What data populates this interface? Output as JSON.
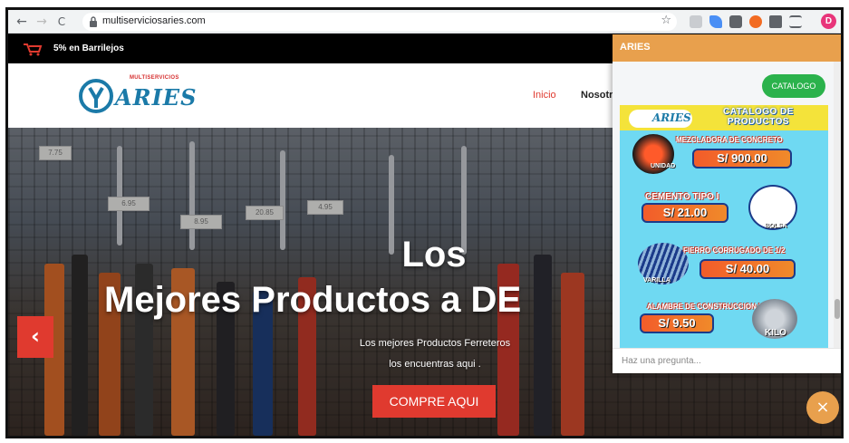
{
  "browser": {
    "url": "multiserviciosaries.com",
    "back": "←",
    "forward": "→",
    "reload": "C",
    "star": "☆",
    "profile_initial": "D"
  },
  "promo": {
    "text": "5% en Barrilejos"
  },
  "header": {
    "logo_small": "MULTISERVICIOS",
    "logo_main": "ARIES",
    "nav": [
      {
        "label": "Inicio",
        "active": true
      },
      {
        "label": "Nosotr",
        "active": false
      }
    ]
  },
  "hero": {
    "title_line1": "Los",
    "title_line2": "Mejores Productos a DE",
    "subtitle_line1": "Los mejores Productos Ferreteros",
    "subtitle_line2": "los encuentras aqui .",
    "cta": "COMPRE AQUI",
    "prev": "‹",
    "price_tags": [
      "7.75",
      "6.95",
      "8.95",
      "20.85",
      "4.95"
    ]
  },
  "chat": {
    "title": "ARIES",
    "catalog_button": "CATALOGO",
    "input_placeholder": "Haz una pregunta...",
    "close": "×",
    "catalog_image": {
      "logo": "ARIES",
      "title_line1": "CATALOGO DE",
      "title_line2": "PRODUCTOS",
      "items": [
        {
          "name": "MEZCLADORA DE CONCRETO",
          "price": "S/ 900.00",
          "unit": "UNIDAD"
        },
        {
          "name": "CEMENTO TIPO I",
          "price": "S/ 21.00",
          "unit": "BOLSA"
        },
        {
          "name": "FIERRO CORRUGADO DE 1/2",
          "price": "S/ 40.00",
          "unit": "VARILLA"
        },
        {
          "name": "ALAMBRE DE CONSTRUCCION N° 16",
          "price": "S/ 9.50",
          "unit": "KILO"
        }
      ]
    }
  },
  "colors": {
    "accent_red": "#e03a2f",
    "chat_orange": "#e8a04d",
    "catalog_green": "#2bb24c",
    "brand_blue": "#1b7aa8"
  }
}
